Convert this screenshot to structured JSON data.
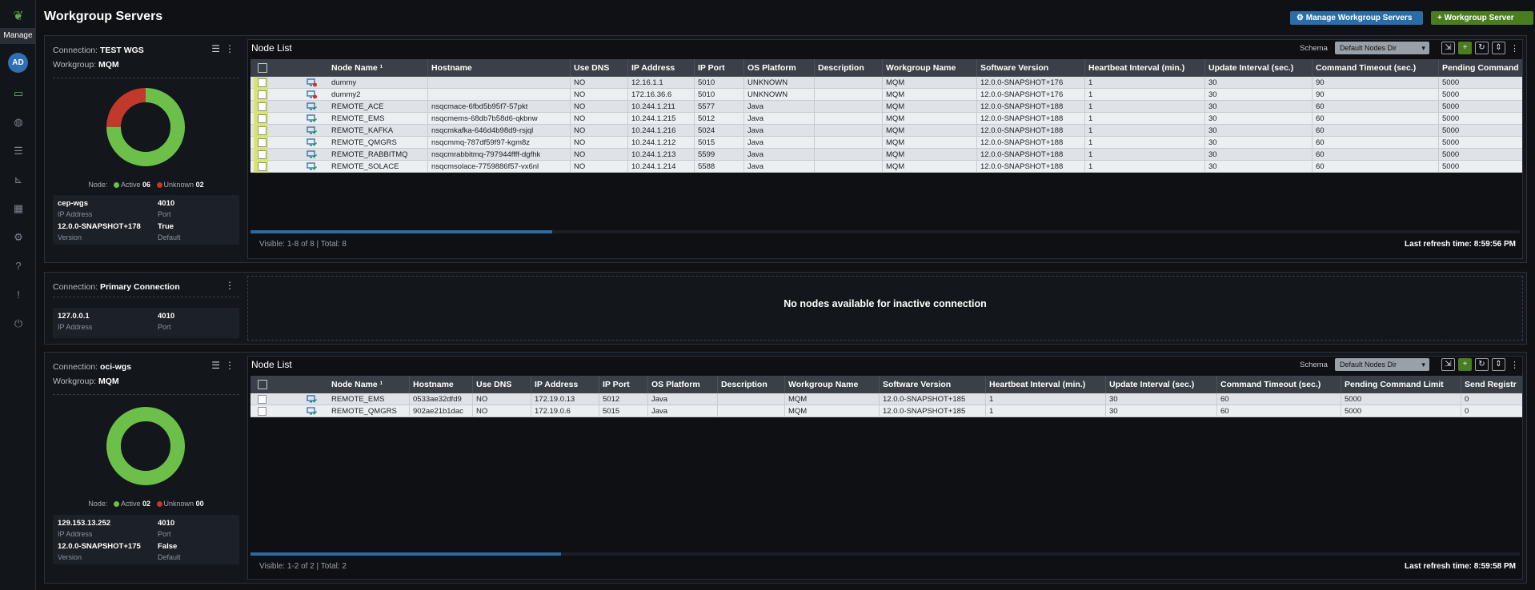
{
  "rail": {
    "manage_label": "Manage",
    "avatar_initials": "AD",
    "icons": [
      "monitor-icon",
      "globe-icon",
      "server-icon",
      "chart-icon",
      "calendar-icon",
      "gear-icon",
      "help-icon",
      "info-icon",
      "power-icon"
    ]
  },
  "header": {
    "title": "Workgroup Servers",
    "manage_button": "Manage Workgroup Servers",
    "add_button": "Workgroup Server"
  },
  "connections": [
    {
      "label": "Connection:",
      "name": "TEST WGS",
      "workgroup_label": "Workgroup:",
      "workgroup": "MQM",
      "node_summary": {
        "label": "Node:",
        "active_label": "Active",
        "active": "06",
        "unknown_label": "Unknown",
        "unknown": "02"
      },
      "active_count": 6,
      "unknown_count": 2,
      "host": "cep-wgs",
      "host_label": "IP Address",
      "port": "4010",
      "port_label": "Port",
      "version": "12.0.0-SNAPSHOT+178",
      "version_label": "Version",
      "default": "True",
      "default_label": "Default",
      "node_list": {
        "title": "Node List",
        "schema_label": "Schema",
        "schema_value": "Default Nodes Dir",
        "columns": [
          "Node Name ¹",
          "Hostname",
          "Use DNS",
          "IP Address",
          "IP Port",
          "OS Platform",
          "Description",
          "Workgroup Name",
          "Software Version",
          "Heartbeat Interval (min.)",
          "Update Interval (sec.)",
          "Command Timeout (sec.)",
          "Pending Command"
        ],
        "rows": [
          {
            "status": "error",
            "cells": [
              "dummy",
              "",
              "NO",
              "12.16.1.1",
              "5010",
              "UNKNOWN",
              "",
              "MQM",
              "12.0.0-SNAPSHOT+176",
              "1",
              "30",
              "90",
              "5000"
            ]
          },
          {
            "status": "error",
            "cells": [
              "dummy2",
              "",
              "NO",
              "172.16.36.6",
              "5010",
              "UNKNOWN",
              "",
              "MQM",
              "12.0.0-SNAPSHOT+176",
              "1",
              "30",
              "90",
              "5000"
            ]
          },
          {
            "status": "ok",
            "cells": [
              "REMOTE_ACE",
              "nsqcmace-6fbd5b95f7-57pkt",
              "NO",
              "10.244.1.211",
              "5577",
              "Java",
              "",
              "MQM",
              "12.0.0-SNAPSHOT+188",
              "1",
              "30",
              "60",
              "5000"
            ]
          },
          {
            "status": "ok",
            "cells": [
              "REMOTE_EMS",
              "nsqcmems-68db7b58d6-qkbnw",
              "NO",
              "10.244.1.215",
              "5012",
              "Java",
              "",
              "MQM",
              "12.0.0-SNAPSHOT+188",
              "1",
              "30",
              "60",
              "5000"
            ]
          },
          {
            "status": "ok",
            "cells": [
              "REMOTE_KAFKA",
              "nsqcmkafka-646d4b98d9-rsjql",
              "NO",
              "10.244.1.216",
              "5024",
              "Java",
              "",
              "MQM",
              "12.0.0-SNAPSHOT+188",
              "1",
              "30",
              "60",
              "5000"
            ]
          },
          {
            "status": "ok",
            "cells": [
              "REMOTE_QMGRS",
              "nsqcmmq-787df59f97-kgm8z",
              "NO",
              "10.244.1.212",
              "5015",
              "Java",
              "",
              "MQM",
              "12.0.0-SNAPSHOT+188",
              "1",
              "30",
              "60",
              "5000"
            ]
          },
          {
            "status": "ok",
            "cells": [
              "REMOTE_RABBITMQ",
              "nsqcmrabbitmq-797944ffff-dgfhk",
              "NO",
              "10.244.1.213",
              "5599",
              "Java",
              "",
              "MQM",
              "12.0.0-SNAPSHOT+188",
              "1",
              "30",
              "60",
              "5000"
            ]
          },
          {
            "status": "ok",
            "cells": [
              "REMOTE_SOLACE",
              "nsqcmsolace-7759886f57-vx6nl",
              "NO",
              "10.244.1.214",
              "5588",
              "Java",
              "",
              "MQM",
              "12.0.0-SNAPSHOT+188",
              "1",
              "30",
              "60",
              "5000"
            ]
          }
        ],
        "visible_text": "Visible: 1-8 of 8 | Total: 8",
        "refresh_text": "Last refresh time: 8:59:56 PM"
      }
    },
    {
      "label": "Connection:",
      "name": "Primary Connection",
      "host": "127.0.0.1",
      "host_label": "IP Address",
      "port": "4010",
      "port_label": "Port",
      "empty_message": "No nodes available for inactive connection"
    },
    {
      "label": "Connection:",
      "name": "oci-wgs",
      "workgroup_label": "Workgroup:",
      "workgroup": "MQM",
      "node_summary": {
        "label": "Node:",
        "active_label": "Active",
        "active": "02",
        "unknown_label": "Unknown",
        "unknown": "00"
      },
      "active_count": 2,
      "unknown_count": 0,
      "host": "129.153.13.252",
      "host_label": "IP Address",
      "port": "4010",
      "port_label": "Port",
      "version": "12.0.0-SNAPSHOT+175",
      "version_label": "Version",
      "default": "False",
      "default_label": "Default",
      "node_list": {
        "title": "Node List",
        "schema_label": "Schema",
        "schema_value": "Default Nodes Dir",
        "columns": [
          "Node Name ¹",
          "Hostname",
          "Use DNS",
          "IP Address",
          "IP Port",
          "OS Platform",
          "Description",
          "Workgroup Name",
          "Software Version",
          "Heartbeat Interval (min.)",
          "Update Interval (sec.)",
          "Command Timeout (sec.)",
          "Pending Command Limit",
          "Send Registr"
        ],
        "rows": [
          {
            "status": "ok",
            "cells": [
              "REMOTE_EMS",
              "0533ae32dfd9",
              "NO",
              "172.19.0.13",
              "5012",
              "Java",
              "",
              "MQM",
              "12.0.0-SNAPSHOT+185",
              "1",
              "30",
              "60",
              "5000",
              "0"
            ]
          },
          {
            "status": "ok",
            "cells": [
              "REMOTE_QMGRS",
              "902ae21b1dac",
              "NO",
              "172.19.0.6",
              "5015",
              "Java",
              "",
              "MQM",
              "12.0.0-SNAPSHOT+185",
              "1",
              "30",
              "60",
              "5000",
              "0"
            ]
          }
        ],
        "visible_text": "Visible: 1-2 of 2 | Total: 2",
        "refresh_text": "Last refresh time: 8:59:58 PM"
      }
    }
  ],
  "colors": {
    "active": "#6cc04a",
    "unknown": "#c0392b",
    "accent_blue": "#2a6ea8",
    "accent_green": "#4a7d1f"
  }
}
